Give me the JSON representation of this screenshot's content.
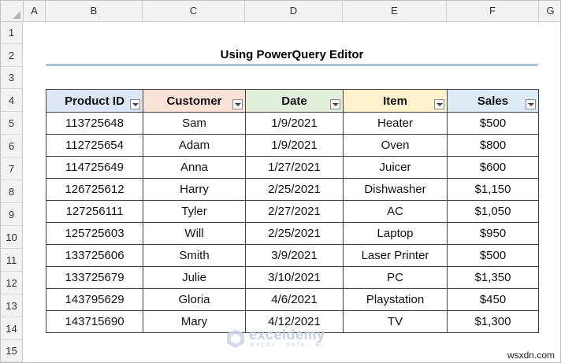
{
  "columns": [
    "A",
    "B",
    "C",
    "D",
    "E",
    "F",
    "G"
  ],
  "rows": [
    "1",
    "2",
    "3",
    "4",
    "5",
    "6",
    "7",
    "8",
    "9",
    "10",
    "11",
    "12",
    "13",
    "14",
    "15"
  ],
  "title": "Using PowerQuery Editor",
  "table": {
    "headers": [
      "Product ID",
      "Customer",
      "Date",
      "Item",
      "Sales"
    ],
    "header_colors": [
      "#dce6f5",
      "#fbe2d8",
      "#e2efda",
      "#fff2cc",
      "#ddebf7"
    ],
    "rows": [
      [
        "113725648",
        "Sam",
        "1/9/2021",
        "Heater",
        "$500"
      ],
      [
        "112725654",
        "Adam",
        "1/9/2021",
        "Oven",
        "$800"
      ],
      [
        "114725649",
        "Anna",
        "1/27/2021",
        "Juicer",
        "$600"
      ],
      [
        "126725612",
        "Harry",
        "2/25/2021",
        "Dishwasher",
        "$1,150"
      ],
      [
        "127256111",
        "Tyler",
        "2/27/2021",
        "AC",
        "$1,050"
      ],
      [
        "125725603",
        "Will",
        "2/25/2021",
        "Laptop",
        "$950"
      ],
      [
        "133725606",
        "Smith",
        "3/9/2021",
        "Laser Printer",
        "$500"
      ],
      [
        "133725679",
        "Julie",
        "3/10/2021",
        "PC",
        "$1,350"
      ],
      [
        "143795629",
        "Gloria",
        "4/6/2021",
        "Playstation",
        "$450"
      ],
      [
        "143715690",
        "Mary",
        "4/12/2021",
        "TV",
        "$1,300"
      ]
    ]
  },
  "watermark": {
    "name": "exceldemy",
    "tagline": "EXCEL · DATA · BI"
  },
  "credit": "wsxdn.com"
}
